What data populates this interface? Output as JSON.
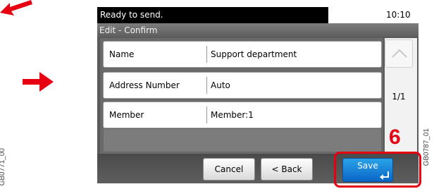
{
  "status_bar": {
    "message": "Ready to send.",
    "time": "10:10"
  },
  "window": {
    "title": "Edit - Confirm"
  },
  "rows": [
    {
      "label": "Name",
      "value": "Support department"
    },
    {
      "label": "Address Number",
      "value": "Auto"
    },
    {
      "label": "Member",
      "value": "Member:1"
    }
  ],
  "pagination": {
    "indicator": "1/1"
  },
  "buttons": {
    "cancel": "Cancel",
    "back": "< Back",
    "save": "Save"
  },
  "annotations": {
    "step_number": "6",
    "figure_code_right": "GB0787_01",
    "figure_code_left": "GB0771_00"
  },
  "colors": {
    "highlight": "#e60012",
    "save_button": "#1a86da",
    "panel": "#5a5a5a"
  },
  "icons": [
    "arrow-icon",
    "arrow-icon",
    "scroll-up-icon",
    "enter-icon"
  ]
}
